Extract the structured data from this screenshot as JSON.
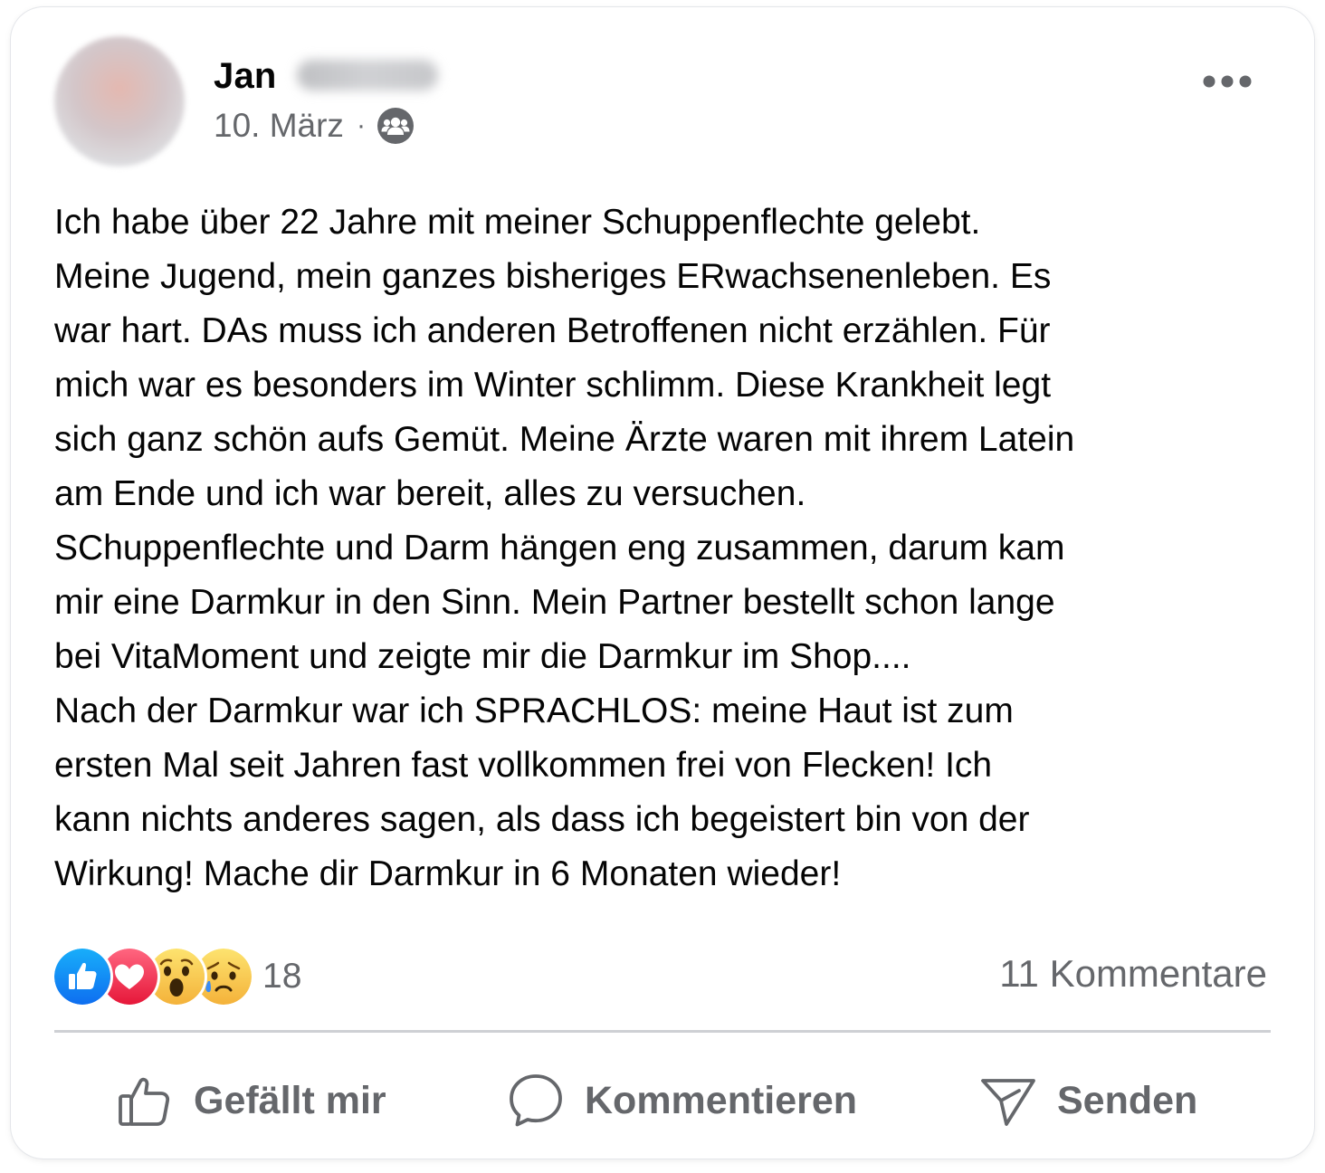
{
  "post": {
    "author_first_name": "Jan",
    "date": "10. März",
    "separator": "·",
    "audience_icon": "group-icon",
    "more_icon": "more-options-icon",
    "text": "Ich habe über 22 Jahre mit meiner Schuppenflechte gelebt.\nMeine Jugend, mein ganzes bisheriges ERwachsenenleben. Es\nwar hart. DAs muss ich anderen Betroffenen nicht erzählen. Für\nmich war es besonders im Winter schlimm. Diese Krankheit legt\nsich ganz schön aufs Gemüt. Meine Ärzte waren mit ihrem Latein\nam Ende und ich war bereit, alles zu versuchen.\nSChuppenflechte und Darm hängen eng zusammen, darum kam\nmir eine Darmkur in den Sinn. Mein Partner bestellt schon lange\nbei VitaMoment und zeigte mir die Darmkur im Shop....\nNach der Darmkur war ich SPRACHLOS: meine Haut ist zum\nersten Mal seit Jahren fast vollkommen frei von Flecken! Ich\nkann nichts anderes sagen, als dass ich begeistert bin von der\nWirkung! Mache dir Darmkur in 6 Monaten wieder!"
  },
  "reactions": {
    "icons": [
      "like-reaction-icon",
      "love-reaction-icon",
      "wow-reaction-icon",
      "sad-reaction-icon"
    ],
    "count": "18",
    "comments": "11 Kommentare"
  },
  "actions": {
    "like_label": "Gefällt mir",
    "comment_label": "Kommentieren",
    "share_label": "Senden"
  },
  "colors": {
    "text": "#050505",
    "secondary_text": "#65676b",
    "like_blue": "#1877f2",
    "love_red": "#f33e58",
    "emoji_yellow": "#fcc74a",
    "divider": "#ced0d4"
  }
}
